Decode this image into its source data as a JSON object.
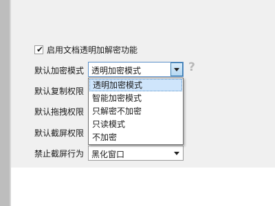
{
  "encryption_checkbox": {
    "checked": true,
    "label": "启用文档透明加解密功能"
  },
  "fields": [
    {
      "label": "默认加密模式",
      "value": "透明加密模式"
    },
    {
      "label": "默认复制权限"
    },
    {
      "label": "默认拖拽权限"
    },
    {
      "label": "默认截屏权限"
    },
    {
      "label": "禁止截屏行为",
      "value": "黑化窗口"
    }
  ],
  "help_icon": "?",
  "dropdown_options": [
    {
      "label": "透明加密模式",
      "selected": true
    },
    {
      "label": "智能加密模式"
    },
    {
      "label": "只解密不加密"
    },
    {
      "label": "只读模式"
    },
    {
      "label": "不加密"
    }
  ],
  "colors": {
    "selected_bg": "#cfe5fb",
    "panel_bg": "#f0f0f0",
    "accent": "#3c7fb1"
  },
  "icons": {
    "check": "check-icon",
    "help": "help-icon",
    "arrow": "chevron-down-icon"
  }
}
